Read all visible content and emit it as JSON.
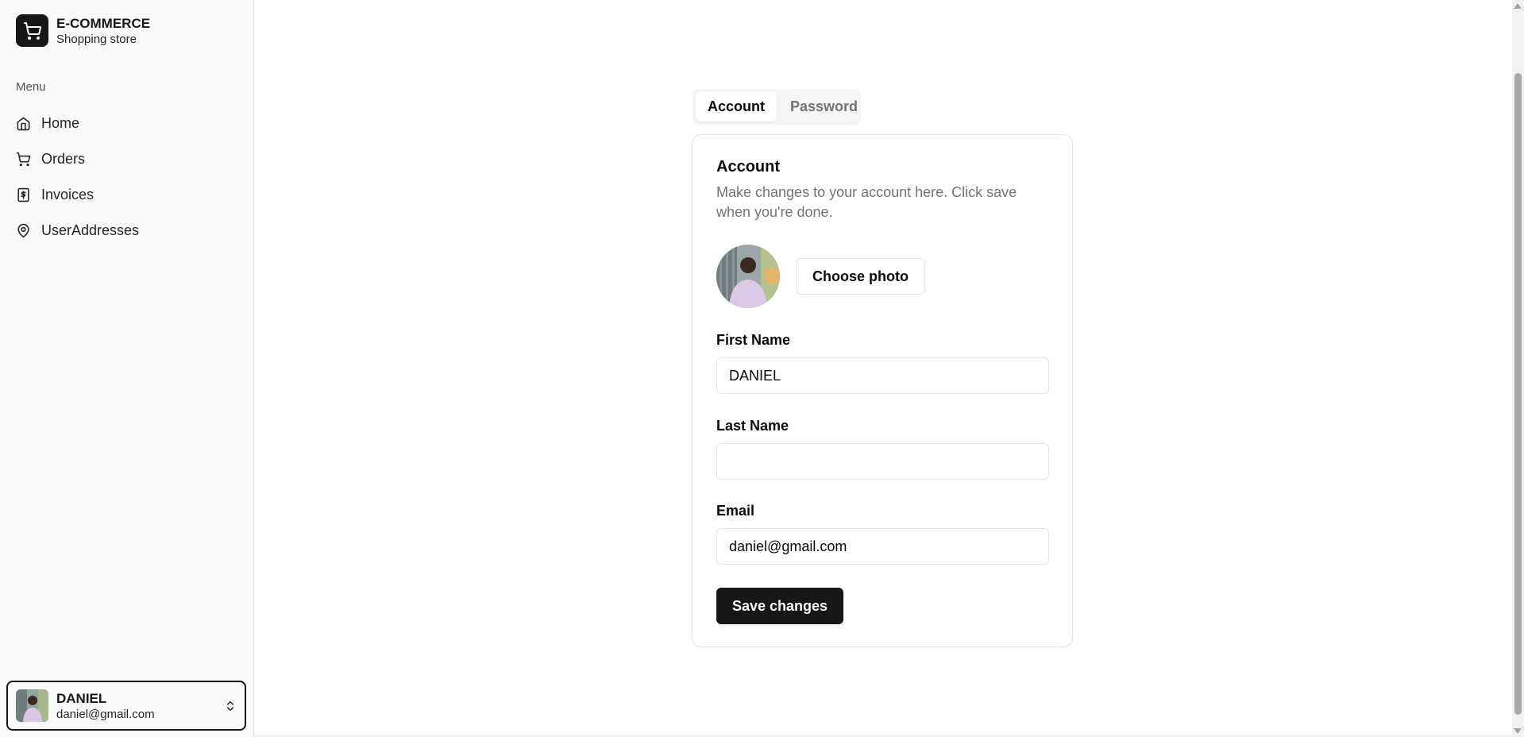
{
  "brand": {
    "title": "E-COMMERCE",
    "subtitle": "Shopping store",
    "logo_icon": "shopping-cart-icon"
  },
  "sidebar": {
    "menu_label": "Menu",
    "items": [
      {
        "label": "Home",
        "icon": "home-icon"
      },
      {
        "label": "Orders",
        "icon": "shopping-cart-icon"
      },
      {
        "label": "Invoices",
        "icon": "receipt-dollar-icon"
      },
      {
        "label": "UserAddresses",
        "icon": "map-pin-icon"
      }
    ]
  },
  "user": {
    "name": "DANIEL",
    "email": "daniel@gmail.com",
    "switch_icon": "chevrons-up-down-icon"
  },
  "tabs": [
    {
      "label": "Account",
      "active": true
    },
    {
      "label": "Password",
      "active": false
    }
  ],
  "account": {
    "title": "Account",
    "description": "Make changes to your account here. Click save when you're done.",
    "choose_photo_label": "Choose photo",
    "first_name": {
      "label": "First Name",
      "value": "DANIEL"
    },
    "last_name": {
      "label": "Last Name",
      "value": ""
    },
    "email": {
      "label": "Email",
      "value": "daniel@gmail.com"
    },
    "save_label": "Save changes"
  },
  "colors": {
    "primary": "#171717",
    "muted_text": "#737373",
    "border": "#e5e5e5",
    "sidebar_bg": "#fafafa"
  }
}
